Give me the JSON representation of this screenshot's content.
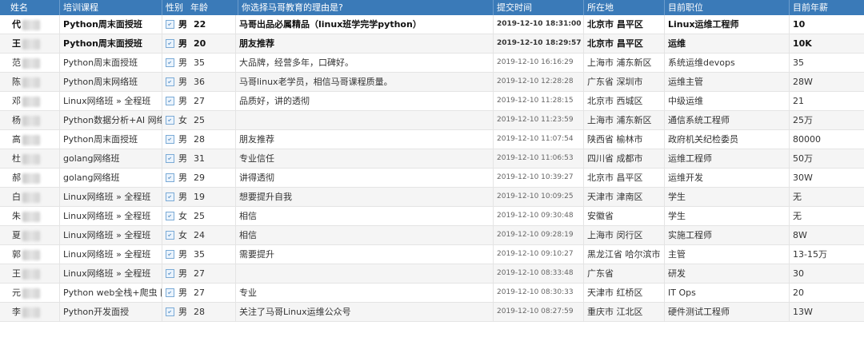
{
  "headers": {
    "name": "姓名",
    "course": "培训课程",
    "gender": "性别",
    "age": "年龄",
    "reason": "你选择马哥教育的理由是?",
    "time": "提交时间",
    "location": "所在地",
    "position": "目前职位",
    "salary": "目前年薪"
  },
  "rows": [
    {
      "name": "代",
      "course": "Python周末面授班",
      "gender": "男",
      "age": "22",
      "reason": "马哥出品必属精品（linux班学完学python）",
      "time": "2019-12-10 18:31:00",
      "location": "北京市 昌平区",
      "position": "Linux运维工程师",
      "salary": "10",
      "bold": true
    },
    {
      "name": "王",
      "course": "Python周末面授班",
      "gender": "男",
      "age": "20",
      "reason": "朋友推荐",
      "time": "2019-12-10 18:29:57",
      "location": "北京市 昌平区",
      "position": "运维",
      "salary": "10K",
      "bold": true
    },
    {
      "name": "范",
      "course": "Python周末面授班",
      "gender": "男",
      "age": "35",
      "reason": "大品牌，经营多年，口碑好。",
      "time": "2019-12-10 16:16:29",
      "location": "上海市 浦东新区",
      "position": "系统运维devops",
      "salary": "35"
    },
    {
      "name": "陈",
      "course": "Python周末网络班",
      "gender": "男",
      "age": "36",
      "reason": "马哥linux老学员，相信马哥课程质量。",
      "time": "2019-12-10 12:28:28",
      "location": "广东省 深圳市",
      "position": "运维主管",
      "salary": "28W"
    },
    {
      "name": "邓",
      "course": "Linux网络班 » 全程班",
      "gender": "男",
      "age": "27",
      "reason": "品质好，讲的透彻",
      "time": "2019-12-10 11:28:15",
      "location": "北京市 西城区",
      "position": "中级运维",
      "salary": "21"
    },
    {
      "name": "杨",
      "course": "Python数据分析+AI 网络班",
      "gender": "女",
      "age": "25",
      "reason": "",
      "time": "2019-12-10 11:23:59",
      "location": "上海市 浦东新区",
      "position": "通信系统工程师",
      "salary": "25万"
    },
    {
      "name": "高",
      "course": "Python周末面授班",
      "gender": "男",
      "age": "28",
      "reason": "朋友推荐",
      "time": "2019-12-10 11:07:54",
      "location": "陕西省 榆林市",
      "position": "政府机关纪检委员",
      "salary": "80000"
    },
    {
      "name": "杜",
      "course": "golang网络班",
      "gender": "男",
      "age": "31",
      "reason": "专业信任",
      "time": "2019-12-10 11:06:53",
      "location": "四川省 成都市",
      "position": "运维工程师",
      "salary": "50万"
    },
    {
      "name": "郝",
      "course": "golang网络班",
      "gender": "男",
      "age": "29",
      "reason": "讲得透彻",
      "time": "2019-12-10 10:39:27",
      "location": "北京市 昌平区",
      "position": "运维开发",
      "salary": "30W"
    },
    {
      "name": "白",
      "course": "Linux网络班 » 全程班",
      "gender": "男",
      "age": "19",
      "reason": "想要提升自我",
      "time": "2019-12-10 10:09:25",
      "location": "天津市 津南区",
      "position": "学生",
      "salary": "无"
    },
    {
      "name": "朱",
      "course": "Linux网络班 » 全程班",
      "gender": "女",
      "age": "25",
      "reason": "相信",
      "time": "2019-12-10 09:30:48",
      "location": "安徽省",
      "position": "学生",
      "salary": "无"
    },
    {
      "name": "夏",
      "course": "Linux网络班 » 全程班",
      "gender": "女",
      "age": "24",
      "reason": "相信",
      "time": "2019-12-10 09:28:19",
      "location": "上海市 闵行区",
      "position": "实施工程师",
      "salary": "8W"
    },
    {
      "name": "郭",
      "course": "Linux网络班 » 全程班",
      "gender": "男",
      "age": "35",
      "reason": "需要提升",
      "time": "2019-12-10 09:10:27",
      "location": "黑龙江省 哈尔滨市",
      "position": "主管",
      "salary": "13-15万"
    },
    {
      "name": "王",
      "course": "Linux网络班 » 全程班",
      "gender": "男",
      "age": "27",
      "reason": "",
      "time": "2019-12-10 08:33:48",
      "location": "广东省",
      "position": "研发",
      "salary": "30"
    },
    {
      "name": "元",
      "course": "Python web全栈+爬虫 网络班",
      "gender": "男",
      "age": "27",
      "reason": "专业",
      "time": "2019-12-10 08:30:33",
      "location": "天津市 红桥区",
      "position": "IT Ops",
      "salary": "20"
    },
    {
      "name": "李",
      "course": "Python开发面授",
      "gender": "男",
      "age": "28",
      "reason": "关注了马哥Linux运维公众号",
      "time": "2019-12-10 08:27:59",
      "location": "重庆市 江北区",
      "position": "硬件测试工程师",
      "salary": "13W"
    }
  ]
}
